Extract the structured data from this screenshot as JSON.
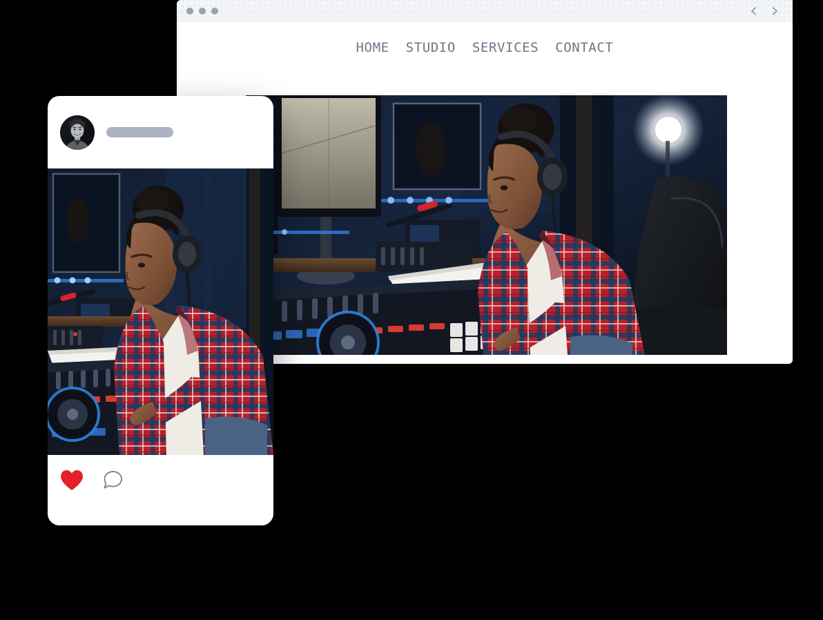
{
  "scene": {
    "background_color": "#000000",
    "description": "Website mockup: desktop browser window with music studio hero photo and an overlapping mobile social-media post card"
  },
  "browser": {
    "titlebar": {
      "window_dots": [
        "red-dot",
        "yellow-dot",
        "green-dot"
      ],
      "dot_color": "#9aa1ac",
      "background_color": "#f2f4f8",
      "nav_back_label": "‹",
      "nav_forward_label": "›"
    },
    "site_nav": {
      "items": [
        {
          "label": "HOME"
        },
        {
          "label": "STUDIO"
        },
        {
          "label": "SERVICES"
        },
        {
          "label": "CONTACT"
        }
      ],
      "text_color": "#6c7684"
    },
    "hero": {
      "image_alt": "Woman in red plaid shirt with headphones working at a DJ mixing console in a dark blue recording studio"
    }
  },
  "mobile_card": {
    "header": {
      "avatar_alt": "Grayscale circular profile photo of a smiling young man with curly hair",
      "username_placeholder_color": "#aeb3c4"
    },
    "post": {
      "image_alt": "Woman in red plaid shirt with headphones working at a DJ mixing console in a dark blue recording studio"
    },
    "actions": [
      {
        "name": "like-icon",
        "label": "Like",
        "color": "#e5202a",
        "filled": true
      },
      {
        "name": "comment-icon",
        "label": "Comment",
        "color": "#7a8496",
        "filled": false
      }
    ]
  },
  "colors": {
    "accent_red": "#e5202a",
    "icon_gray": "#7a8496",
    "nav_gray": "#6c7684",
    "titlebar_gray": "#f2f4f8",
    "card_white": "#ffffff",
    "page_black": "#000000"
  }
}
